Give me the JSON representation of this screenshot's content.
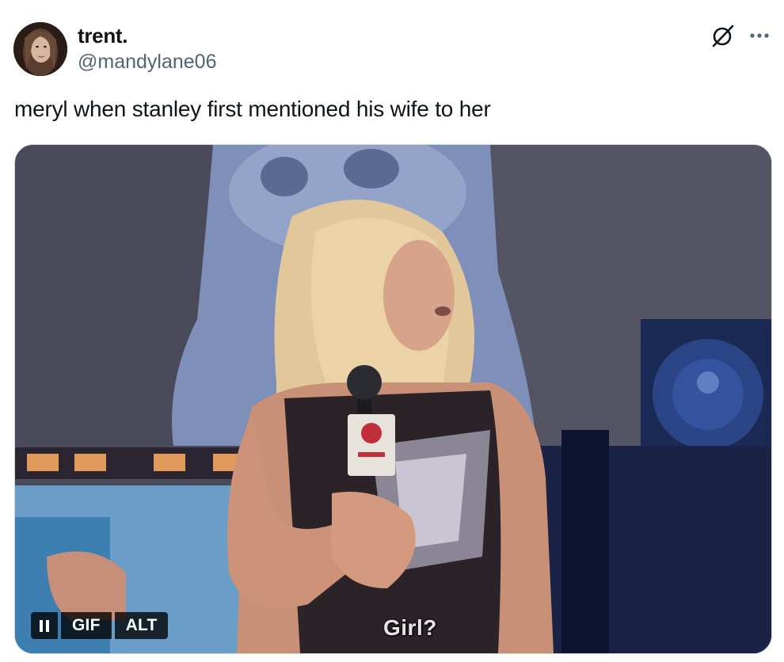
{
  "author": {
    "display_name": "trent.",
    "handle": "@mandylane06"
  },
  "icons": {
    "grok": "grok-icon",
    "more": "more-horizontal-icon",
    "pause": "pause-icon"
  },
  "tweet": {
    "text": "meryl when stanley first mentioned his wife to her"
  },
  "media": {
    "caption": "Girl?",
    "gif_label": "GIF",
    "alt_label": "ALT"
  }
}
